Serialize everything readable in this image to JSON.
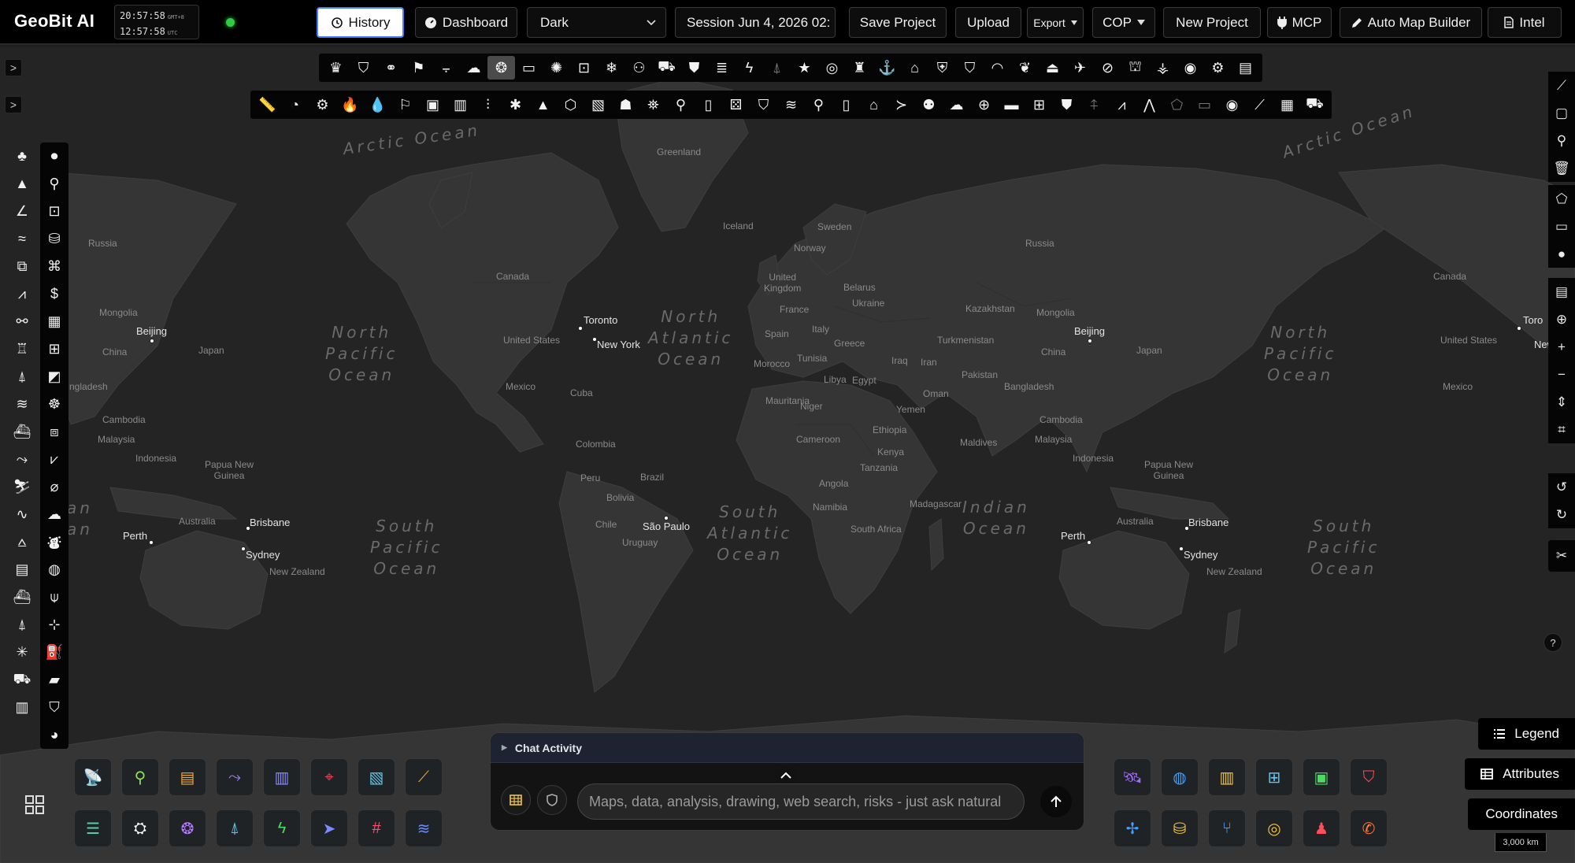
{
  "app": {
    "title": "GeoBit AI",
    "clock": {
      "local_time": "20:57:58",
      "local_zone": "GMT+8",
      "utc_time": "12:57:58",
      "utc_zone": "UTC"
    },
    "status_color": "#2ecc40"
  },
  "topbar": {
    "history_label": "History",
    "dashboard_label": "Dashboard",
    "theme_select": {
      "value": "Dark"
    },
    "session_label": "Session Jun 4, 2026 02:",
    "save_project_label": "Save Project",
    "upload_label": "Upload",
    "export_label": "Export",
    "cop_label": "COP",
    "new_project_label": "New Project",
    "mcp_label": "MCP",
    "auto_map_builder_label": "Auto Map Builder",
    "intel_label": "Intel"
  },
  "map": {
    "theme": "dark",
    "oceans": {
      "arctic_left": "Arctic Ocean",
      "arctic_right": "Arctic Ocean",
      "north_pacific_left": "North\nPacific\nOcean",
      "north_atlantic": "North\nAtlantic\nOcean",
      "north_pacific_right": "North\nPacific\nOcean",
      "south_pacific_left": "South\nPacific\nOcean",
      "south_atlantic": "South\nAtlantic\nOcean",
      "indian": "Indian\nOcean",
      "south_pacific_right": "South\nPacific\nOcean"
    },
    "places": {
      "greenland": "Greenland",
      "iceland": "Iceland",
      "sweden": "Sweden",
      "norway": "Norway",
      "united_kingdom": "United\nKingdom",
      "belarus": "Belarus",
      "ukraine": "Ukraine",
      "france": "France",
      "spain": "Spain",
      "italy": "Italy",
      "greece": "Greece",
      "tunisia": "Tunisia",
      "morocco": "Morocco",
      "libya": "Libya",
      "egypt": "Egypt",
      "mauritania": "Mauritania",
      "niger": "Niger",
      "cameroon": "Cameroon",
      "ethiopia": "Ethiopia",
      "kenya": "Kenya",
      "tanzania": "Tanzania",
      "angola": "Angola",
      "namibia": "Namibia",
      "south_africa": "South Africa",
      "madagascar": "Madagascar",
      "yemen": "Yemen",
      "oman": "Oman",
      "iraq": "Iraq",
      "iran": "Iran",
      "pakistan": "Pakistan",
      "kazakhstan": "Kazakhstan",
      "turkmenistan": "Turkmenistan",
      "russia_center": "Russia",
      "russia_left": "Russia",
      "mongolia_left": "Mongolia",
      "mongolia_right": "Mongolia",
      "china_left": "China",
      "china_right": "China",
      "japan_left": "Japan",
      "japan_right": "Japan",
      "bangladesh_left": "ngladesh",
      "bangladesh_right": "Bangladesh",
      "cambodia_left": "Cambodia",
      "cambodia_right": "Cambodia",
      "malaysia_left": "Malaysia",
      "malaysia_right": "Malaysia",
      "indonesia_left": "Indonesia",
      "indonesia_right": "Indonesia",
      "png_left": "Papua New\nGuinea",
      "png_right": "Papua New\nGuinea",
      "australia_left": "Australia",
      "australia_right": "Australia",
      "nz_left": "New Zealand",
      "nz_right": "New Zealand",
      "maldives": "Maldives",
      "canada_left": "Canada",
      "canada_right": "Canada",
      "us_left": "United States",
      "us_right": "United States",
      "mexico_left": "Mexico",
      "mexico_right": "Mexico",
      "cuba": "Cuba",
      "colombia": "Colombia",
      "peru": "Peru",
      "brazil": "Brazil",
      "bolivia": "Bolivia",
      "chile": "Chile",
      "uruguay": "Uruguay",
      "an1": "an",
      "an2": "an"
    },
    "cities": {
      "toronto": "Toronto",
      "new_york": "New York",
      "beijing_left": "Beijing",
      "beijing_right": "Beijing",
      "brisbane_left": "Brisbane",
      "brisbane_right": "Brisbane",
      "sydney_left": "Sydney",
      "sydney_right": "Sydney",
      "perth_left": "Perth",
      "perth_right": "Perth",
      "sao_paulo": "São Paulo",
      "toro_edge": "Toro",
      "ny_edge": "New Yor"
    },
    "scale_label": "3,000 km"
  },
  "chat": {
    "header": "Chat Activity",
    "placeholder": "Maps, data, analysis, drawing, web search, risks - just ask natural"
  },
  "panels": {
    "legend_label": "Legend",
    "attributes_label": "Attributes",
    "coordinates_label": "Coordinates",
    "help_label": "?"
  },
  "tiles_left": [
    {
      "icon": "satellite-dish-icon",
      "color": "#e8455a"
    },
    {
      "icon": "map-pin-icon",
      "color": "#8ee05a"
    },
    {
      "icon": "clipboard-icon",
      "color": "#f2a93b"
    },
    {
      "icon": "route-icon",
      "color": "#9b7cff"
    },
    {
      "icon": "newspaper-icon",
      "color": "#8a8cff"
    },
    {
      "icon": "crosshair-icon",
      "color": "#e8455a"
    },
    {
      "icon": "map-icon",
      "color": "#5bc8f0"
    },
    {
      "icon": "chart-line-icon",
      "color": "#f2a93b"
    },
    {
      "icon": "list-icon",
      "color": "#4fd1a5"
    },
    {
      "icon": "robot-icon",
      "color": "#ffffff"
    },
    {
      "icon": "brain-icon",
      "color": "#b77cff"
    },
    {
      "icon": "broadcast-icon",
      "color": "#5bc8f0"
    },
    {
      "icon": "bolt-icon",
      "color": "#4cd964"
    },
    {
      "icon": "telegram-icon",
      "color": "#7a8cff"
    },
    {
      "icon": "hashtag-icon",
      "color": "#ff4d6d"
    },
    {
      "icon": "water-icon",
      "color": "#6a8cff"
    }
  ],
  "tiles_right": [
    {
      "icon": "satellite-icon",
      "color": "#a66cff"
    },
    {
      "icon": "globe-icon",
      "color": "#3fa0ff"
    },
    {
      "icon": "book-icon",
      "color": "#f2c53d"
    },
    {
      "icon": "sitemap-icon",
      "color": "#5bc8f0"
    },
    {
      "icon": "briefcase-icon",
      "color": "#4cd964"
    },
    {
      "icon": "shield-icon",
      "color": "#ff4d5a"
    },
    {
      "icon": "drone-icon",
      "color": "#3fa0ff"
    },
    {
      "icon": "database-icon",
      "color": "#f2c53d"
    },
    {
      "icon": "git-branch-icon",
      "color": "#3fa0ff"
    },
    {
      "icon": "target-icon",
      "color": "#f2c53d"
    },
    {
      "icon": "user-secret-icon",
      "color": "#ff4d5a"
    },
    {
      "icon": "phone-icon",
      "color": "#ff7a3d"
    }
  ]
}
